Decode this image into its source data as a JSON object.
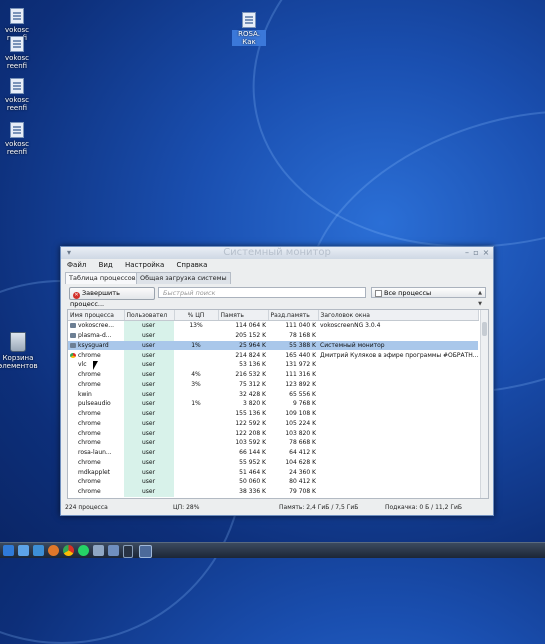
{
  "desktop": {
    "icons": [
      {
        "label": "vokosc reenfi"
      },
      {
        "label": "vokosc reenfi"
      },
      {
        "label": "vokosc reenfi"
      },
      {
        "label": "vokosc reenfi"
      },
      {
        "label": "ROSA. Как"
      },
      {
        "label": "Корзина элементов"
      }
    ]
  },
  "window": {
    "title": "Системный монитор",
    "menu": [
      "Файл",
      "Вид",
      "Настройка",
      "Справка"
    ],
    "tabs": [
      "Таблица процессов",
      "Общая загрузка системы"
    ],
    "kill_button": "Завершить процесс...",
    "search_placeholder": "Быстрый поиск",
    "filter_value": "Все процессы",
    "columns": [
      "Имя процесса",
      "Пользовател",
      "% ЦП",
      "Память",
      "Разд.память",
      "Заголовок окна"
    ],
    "rows": [
      {
        "name": "vokoscree...",
        "user": "user",
        "cpu": "13%",
        "mem": "114 064 K",
        "shared": "111 040 K",
        "title": "vokoscreenNG 3.0.4",
        "icon": "app"
      },
      {
        "name": "plasma-d...",
        "user": "user",
        "cpu": "",
        "mem": "205 152 K",
        "shared": "78 168 K",
        "title": "",
        "icon": "app"
      },
      {
        "name": "ksysguard",
        "user": "user",
        "cpu": "1%",
        "mem": "25 964 K",
        "shared": "55 388 K",
        "title": "Системный монитор",
        "icon": "app",
        "selected": true
      },
      {
        "name": "chrome",
        "user": "user",
        "cpu": "",
        "mem": "214 824 K",
        "shared": "165 440 K",
        "title": "Дмитрий Куляков в эфире программы #ОБРАТН...",
        "icon": "chrome"
      },
      {
        "name": "vlc",
        "user": "user",
        "cpu": "",
        "mem": "53 136 K",
        "shared": "131 972 K",
        "title": "",
        "icon": "blank"
      },
      {
        "name": "chrome",
        "user": "user",
        "cpu": "4%",
        "mem": "216 532 K",
        "shared": "111 316 K",
        "title": "",
        "icon": "blank"
      },
      {
        "name": "chrome",
        "user": "user",
        "cpu": "3%",
        "mem": "75 312 K",
        "shared": "123 892 K",
        "title": "",
        "icon": "blank"
      },
      {
        "name": "kwin",
        "user": "user",
        "cpu": "",
        "mem": "32 428 K",
        "shared": "65 556 K",
        "title": "",
        "icon": "blank"
      },
      {
        "name": "pulseaudio",
        "user": "user",
        "cpu": "1%",
        "mem": "3 820 K",
        "shared": "9 768 K",
        "title": "",
        "icon": "blank"
      },
      {
        "name": "chrome",
        "user": "user",
        "cpu": "",
        "mem": "155 136 K",
        "shared": "109 108 K",
        "title": "",
        "icon": "blank"
      },
      {
        "name": "chrome",
        "user": "user",
        "cpu": "",
        "mem": "122 592 K",
        "shared": "105 224 K",
        "title": "",
        "icon": "blank"
      },
      {
        "name": "chrome",
        "user": "user",
        "cpu": "",
        "mem": "122 208 K",
        "shared": "103 820 K",
        "title": "",
        "icon": "blank"
      },
      {
        "name": "chrome",
        "user": "user",
        "cpu": "",
        "mem": "103 592 K",
        "shared": "78 668 K",
        "title": "",
        "icon": "blank"
      },
      {
        "name": "rosa-laun...",
        "user": "user",
        "cpu": "",
        "mem": "66 144 K",
        "shared": "64 412 K",
        "title": "",
        "icon": "blank"
      },
      {
        "name": "chrome",
        "user": "user",
        "cpu": "",
        "mem": "55 952 K",
        "shared": "104 628 K",
        "title": "",
        "icon": "blank"
      },
      {
        "name": "mdkapplet",
        "user": "user",
        "cpu": "",
        "mem": "51 464 K",
        "shared": "24 360 K",
        "title": "",
        "icon": "blank"
      },
      {
        "name": "chrome",
        "user": "user",
        "cpu": "",
        "mem": "50 060 K",
        "shared": "80 412 K",
        "title": "",
        "icon": "blank"
      },
      {
        "name": "chrome",
        "user": "user",
        "cpu": "",
        "mem": "38 336 K",
        "shared": "79 708 K",
        "title": "",
        "icon": "blank"
      }
    ],
    "status": {
      "processes": "224 процесса",
      "cpu": "ЦП: 28%",
      "memory": "Память: 2,4 ГиБ / 7,5 ГиБ",
      "swap": "Подкачка: 0 Б / 11,2 ГиБ"
    }
  },
  "taskbar": {
    "items": [
      "menu",
      "files",
      "browser",
      "firefox",
      "chrome",
      "whatsapp",
      "player",
      "monitor",
      "terminal",
      "separator",
      "ksysguard"
    ]
  },
  "colors": {
    "desktop_bg": "#1a4fb0",
    "selection": "#a9c7ea",
    "user_column": "#d8f2ea",
    "kill_icon": "#d2302a"
  }
}
